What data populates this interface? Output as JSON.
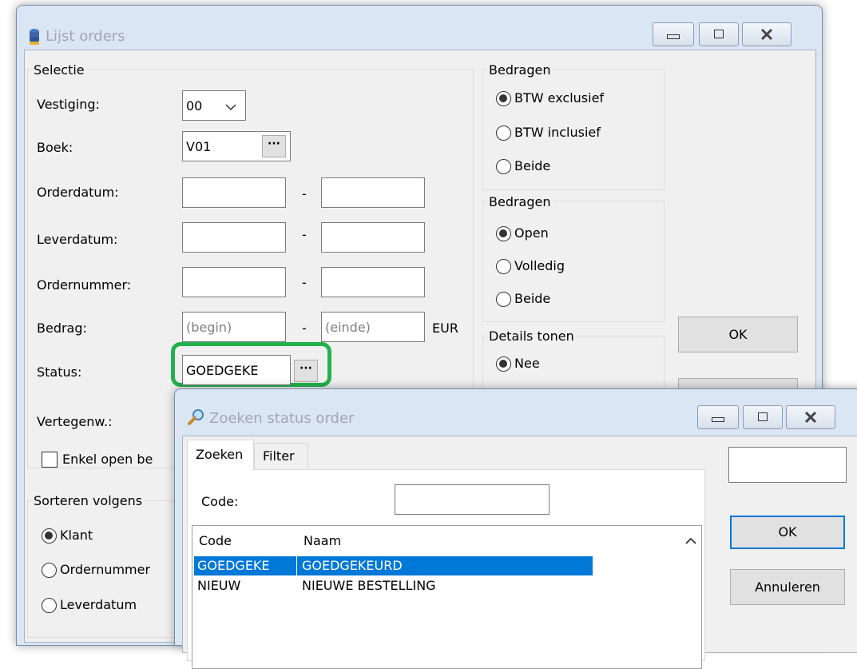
{
  "main_window": {
    "title": "Lijst orders",
    "selectie": {
      "title": "Selectie",
      "vestiging_label": "Vestiging:",
      "vestiging_value": "00",
      "boek_label": "Boek:",
      "boek_value": "V01",
      "orderdatum_label": "Orderdatum:",
      "leverdatum_label": "Leverdatum:",
      "ordernummer_label": "Ordernummer:",
      "bedrag_label": "Bedrag:",
      "bedrag_begin_placeholder": "(begin)",
      "bedrag_einde_placeholder": "(einde)",
      "currency": "EUR",
      "status_label": "Status:",
      "status_value": "GOEDGEKE",
      "vertegenw_label": "Vertegenw.:",
      "enkel_open_label": "Enkel open be",
      "dash": "-",
      "ellipsis": "···"
    },
    "sorteren": {
      "title": "Sorteren volgens",
      "options": [
        "Klant",
        "Ordernummer",
        "Leverdatum"
      ],
      "selected": "Klant"
    },
    "bedragen_btw": {
      "title": "Bedragen",
      "options": [
        "BTW exclusief",
        "BTW inclusief",
        "Beide"
      ],
      "selected": "BTW exclusief"
    },
    "bedragen_status": {
      "title": "Bedragen",
      "options": [
        "Open",
        "Volledig",
        "Beide"
      ],
      "selected": "Open"
    },
    "details": {
      "title": "Details tonen",
      "options": [
        "Nee"
      ],
      "selected": "Nee"
    },
    "ok_label": "OK",
    "highlight_color": "#22b14c"
  },
  "search_dialog": {
    "title": "Zoeken status order",
    "tabs": [
      "Zoeken",
      "Filter"
    ],
    "active_tab": "Zoeken",
    "code_label": "Code:",
    "code_value": "",
    "columns": [
      "Code",
      "Naam"
    ],
    "rows": [
      {
        "code": "GOEDGEKE",
        "naam": "GOEDGEKEURD",
        "selected": true
      },
      {
        "code": "NIEUW",
        "naam": "NIEUWE BESTELLING",
        "selected": false
      }
    ],
    "ok_label": "OK",
    "cancel_label": "Annuleren",
    "selection_color": "#0078d7"
  }
}
